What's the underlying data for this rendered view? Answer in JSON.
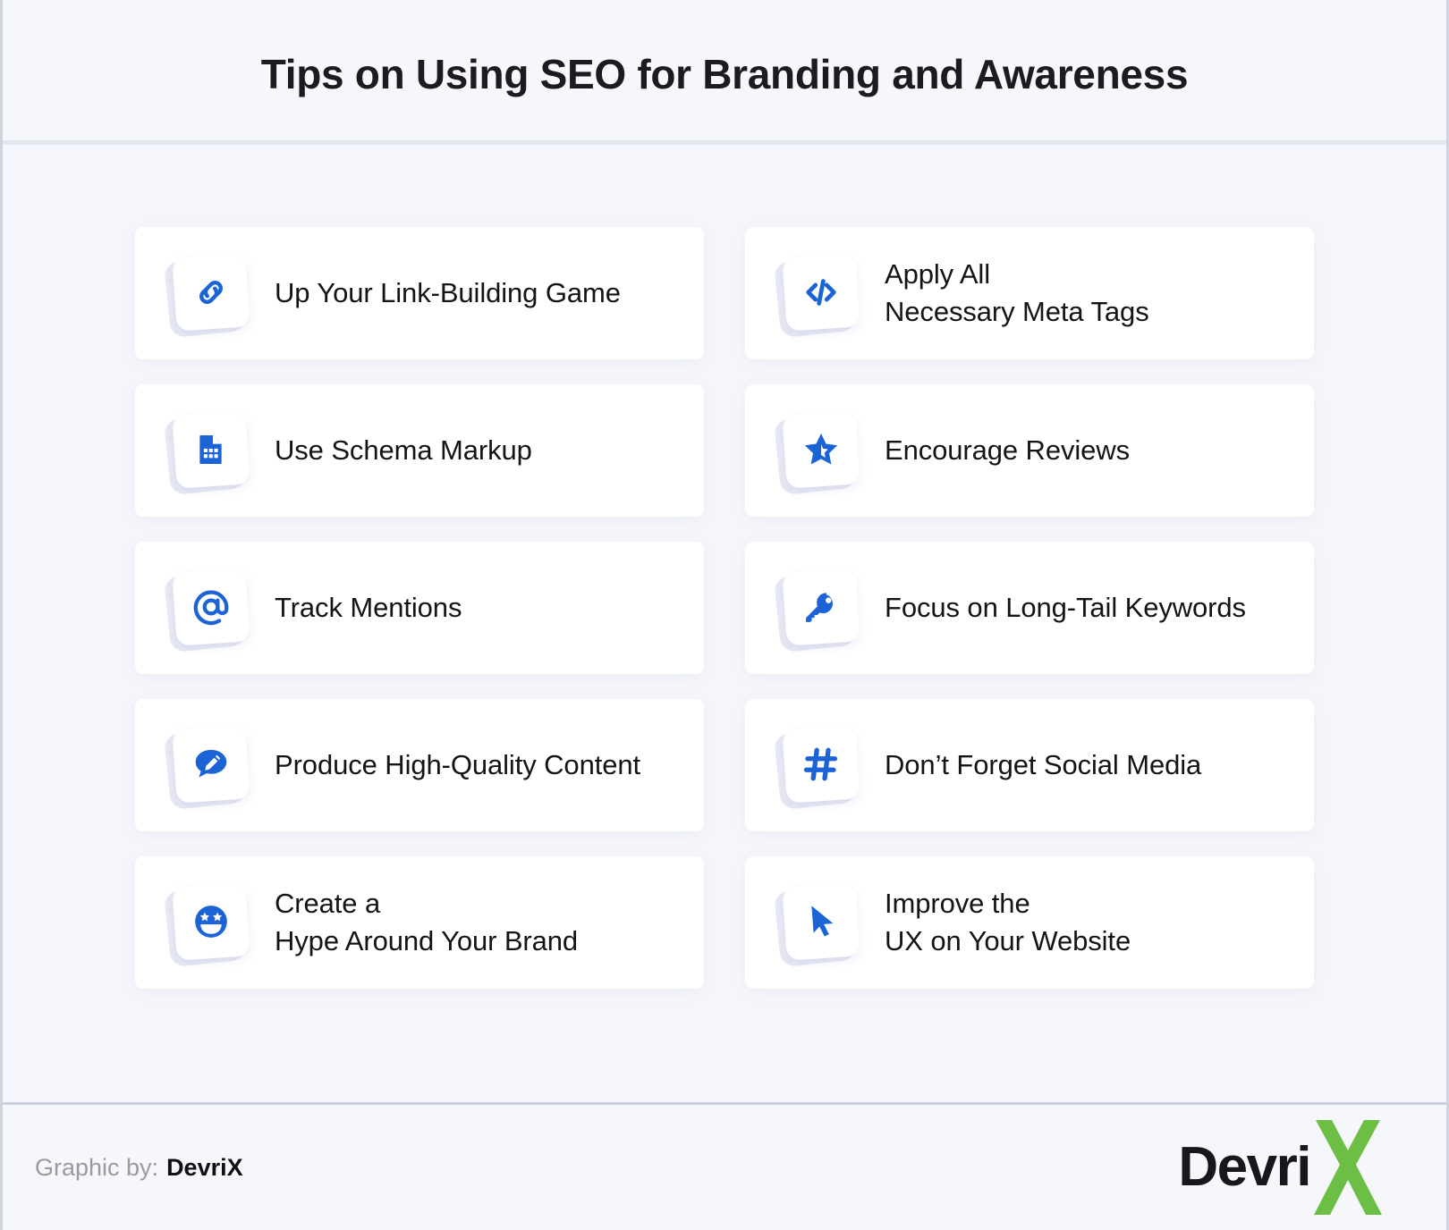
{
  "header": {
    "title": "Tips on Using SEO for Branding and Awareness"
  },
  "colors": {
    "background": "#f5f6fb",
    "card": "#ffffff",
    "accent_blue": "#1c63d6",
    "icon_plate_back": "#e7e9f5",
    "logo_green": "#6cbe45",
    "text": "#141414",
    "muted_text": "#9a9aa2"
  },
  "tips": {
    "left_column": [
      {
        "label": "Up Your Link-Building Game",
        "icon": "link-icon"
      },
      {
        "label": "Use Schema Markup",
        "icon": "document-grid-icon"
      },
      {
        "label": "Track Mentions",
        "icon": "at-sign-icon"
      },
      {
        "label": "Produce High-Quality Content",
        "icon": "speech-bubble-pencil-icon"
      },
      {
        "label": "Create a\nHype Around Your Brand",
        "icon": "star-struck-face-icon"
      }
    ],
    "right_column": [
      {
        "label": "Apply All\nNecessary Meta Tags",
        "icon": "code-brackets-icon"
      },
      {
        "label": "Encourage Reviews",
        "icon": "star-icon"
      },
      {
        "label": "Focus on Long-Tail Keywords",
        "icon": "key-icon"
      },
      {
        "label": "Don’t Forget Social Media",
        "icon": "hashtag-icon"
      },
      {
        "label": "Improve the\nUX on Your Website",
        "icon": "cursor-arrow-icon"
      }
    ]
  },
  "footer": {
    "credit_prefix": "Graphic by:",
    "credit_brand": "DevriX",
    "logo_word": "Devri",
    "logo_mark": "X"
  }
}
